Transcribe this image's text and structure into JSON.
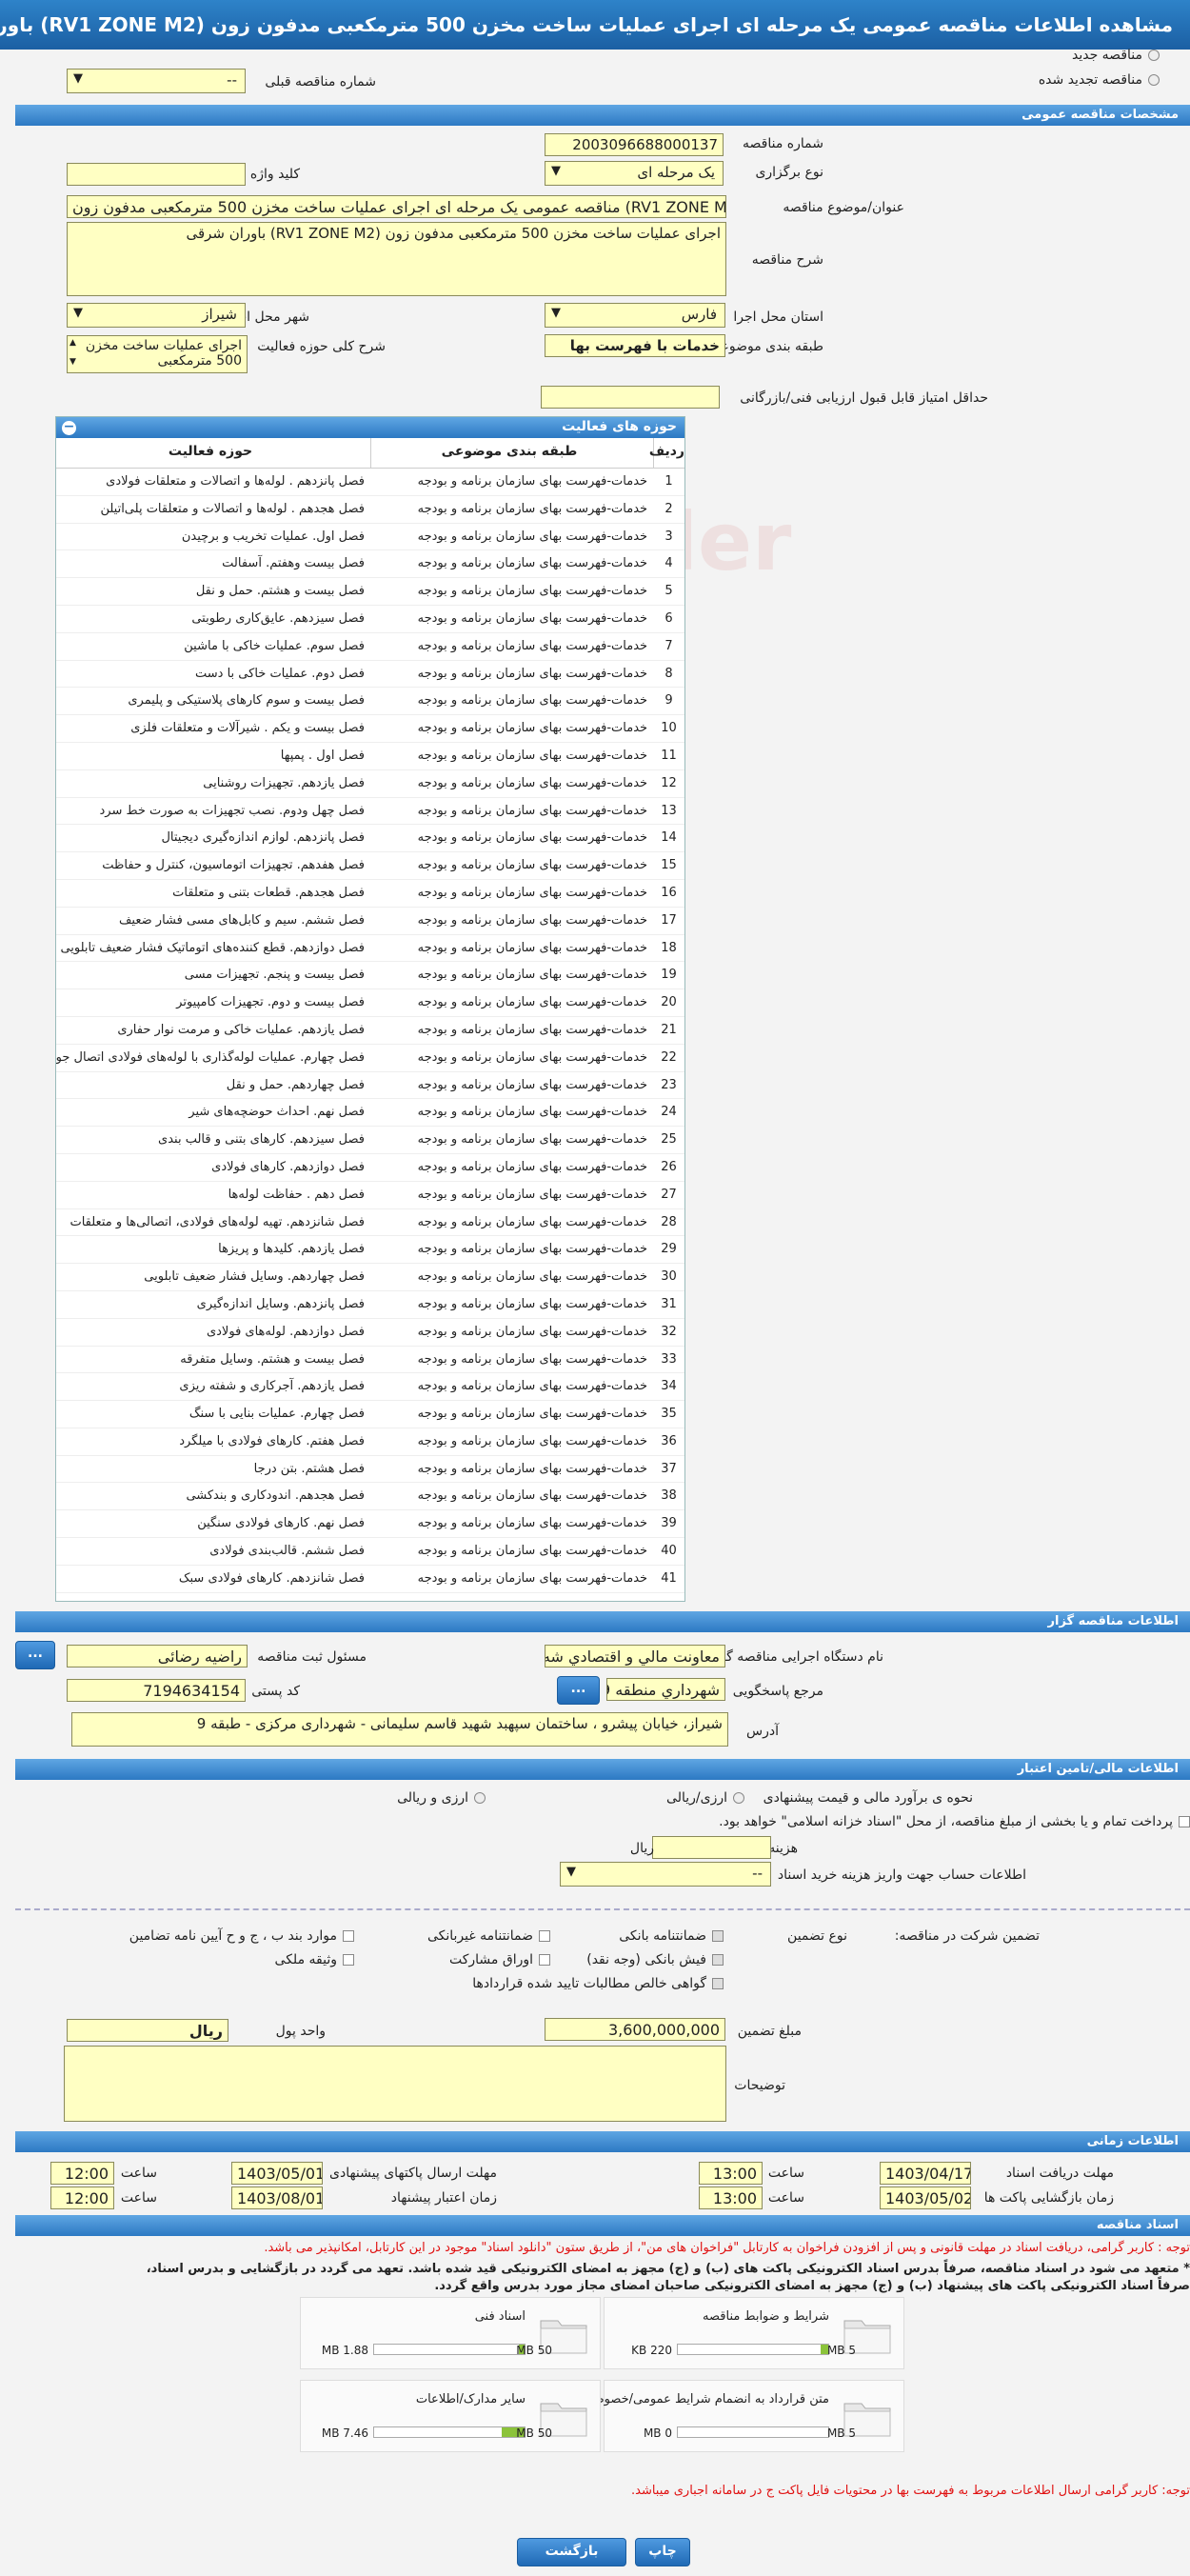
{
  "page_title": "مشاهده اطلاعات مناقصه عمومی یک مرحله ای اجرای عملیات ساخت مخزن 500 مترمکعبی مدفون زون (RV1 ZONE M2) باوران شرقی",
  "top": {
    "new_label": "مناقصه جدید",
    "renewed_label": "مناقصه تجدید شده",
    "prev_number_label": "شماره مناقصه قبلی",
    "prev_number_value": "--"
  },
  "general": {
    "header": "مشخصات مناقصه عمومی",
    "number_label": "شماره مناقصه",
    "number_value": "2003096688000137",
    "type_label": "نوع برگزاری",
    "type_value": "یک مرحله ای",
    "keyword_label": "کلید واژه",
    "subject_label": "عنوان/موضوع مناقصه",
    "subject_value": "مناقصه عمومی یک مرحله ای اجرای عملیات ساخت مخزن 500 مترمکعبی مدفون زون (RV1 ZONE M2",
    "desc_label": "شرح مناقصه",
    "desc_value": "اجرای عملیات ساخت مخزن 500 مترمکعبی مدفون زون (RV1 ZONE M2) باوران شرقی",
    "province_label": "استان محل اجرا",
    "province_value": "فارس",
    "city_label": "شهر محل اجرا",
    "city_value": "شیراز",
    "category_label": "طبقه بندی موضوعی",
    "category_value": "خدمات با فهرست بها",
    "scope_label": "شرح کلی حوزه فعالیت",
    "scope_value": "اجرای عملیات ساخت مخزن 500 مترمکعبی",
    "min_score_label": "حداقل امتیاز قابل قبول ارزیابی فنی/بازرگانی"
  },
  "activities": {
    "header": "حوزه های فعالیت",
    "col_row": "ردیف",
    "col_cat": "طبقه بندی موضوعی",
    "col_field": "حوزه فعالیت",
    "cat_value": "خدمات-فهرست بهای سازمان برنامه و بودجه",
    "rows": [
      {
        "n": "1",
        "f": "فصل پانزدهم . لوله‌ها و اتصالات و متعلقات فولادی"
      },
      {
        "n": "2",
        "f": "فصل هجدهم . لوله‌ها و اتصالات و متعلقات  پلی‌اتیلن"
      },
      {
        "n": "3",
        "f": "فصل اول. عملیات تخریب و برچیدن"
      },
      {
        "n": "4",
        "f": "فصل بیست وهفتم. آسفالت"
      },
      {
        "n": "5",
        "f": "فصل بیست و هشتم. حمل و نقل"
      },
      {
        "n": "6",
        "f": "فصل سیزدهم. عایق‌کاری رطوبتی"
      },
      {
        "n": "7",
        "f": "فصل سوم. عملیات خاکی با ماشین"
      },
      {
        "n": "8",
        "f": "فصل دوم. عملیات خاکی با دست"
      },
      {
        "n": "9",
        "f": "فصل بیست و سوم کارهای پلاستیکی و پلیمری"
      },
      {
        "n": "10",
        "f": "فصل بیست و یکم . شیرآلات و متعلقات فلزی"
      },
      {
        "n": "11",
        "f": "فصل اول . پمپها"
      },
      {
        "n": "12",
        "f": "فصل یازدهم. تجهیزات روشنایی"
      },
      {
        "n": "13",
        "f": "فصل چهل ودوم. نصب تجهیزات به صورت خط سرد"
      },
      {
        "n": "14",
        "f": "فصل پانزدهم. لوازم اندازه‌گیری دیجیتال"
      },
      {
        "n": "15",
        "f": "فصل هفدهم. تجهیزات اتوماسیون، کنترل و حفاظت"
      },
      {
        "n": "16",
        "f": "فصل هجدهم. قطعات بتنی و متعلقات"
      },
      {
        "n": "17",
        "f": "فصل ششم. سیم و کابل‌های مسی فشار ضعیف"
      },
      {
        "n": "18",
        "f": "فصل دوازدهم. قطع کننده‌های اتوماتیک فشار ضعیف تابلویی"
      },
      {
        "n": "19",
        "f": "فصل بیست و پنجم. تجهیزات مسی"
      },
      {
        "n": "20",
        "f": "فصل بیست و دوم. تجهیزات کامپیوتر"
      },
      {
        "n": "21",
        "f": "فصل یازدهم. عملیات خاکی و مرمت نوار حفاری"
      },
      {
        "n": "22",
        "f": "فصل چهارم. عملیات لوله‌گذاری با لوله‌های فولادی اتصال جوشی"
      },
      {
        "n": "23",
        "f": "فصل چهاردهم. حمل و نقل"
      },
      {
        "n": "24",
        "f": "فصل نهم. احداث حوضچه‌های شیر"
      },
      {
        "n": "25",
        "f": "فصل سیزدهم. کارهای بتنی و قالب بندی"
      },
      {
        "n": "26",
        "f": "فصل دوازدهم. کارهای فولادی"
      },
      {
        "n": "27",
        "f": "فصل دهم . حفاظت لوله‌ها"
      },
      {
        "n": "28",
        "f": "فصل شانزدهم. تهیه لوله‌های فولادی، اتصالی‌ها و متعلقات"
      },
      {
        "n": "29",
        "f": "فصل یازدهم. کلیدها و پریزها"
      },
      {
        "n": "30",
        "f": "فصل چهاردهم. وسایل فشار ضعیف تابلویی"
      },
      {
        "n": "31",
        "f": "فصل پانزدهم. وسایل اندازه‌گیری"
      },
      {
        "n": "32",
        "f": "فصل دوازدهم. لوله‌های فولادی"
      },
      {
        "n": "33",
        "f": "فصل بیست و هشتم. وسایل متفرقه"
      },
      {
        "n": "34",
        "f": "فصل یازدهم. آجرکاری و شفته ریزی"
      },
      {
        "n": "35",
        "f": "فصل چهارم. عملیات بنایی با سنگ"
      },
      {
        "n": "36",
        "f": "فصل هفتم. کارهای فولادی با میلگرد"
      },
      {
        "n": "37",
        "f": "فصل هشتم. بتن درجا"
      },
      {
        "n": "38",
        "f": "فصل هجدهم. اندودکاری و بندکشی"
      },
      {
        "n": "39",
        "f": "فصل نهم. کارهای فولادی سنگین"
      },
      {
        "n": "40",
        "f": "فصل ششم. قالب‌بندی فولادی"
      },
      {
        "n": "41",
        "f": "فصل شانزدهم. کارهای فولادی سبک"
      }
    ]
  },
  "organizer": {
    "header": "اطلاعات مناقصه گزار",
    "org_label": "نام دستگاه اجرایی مناقصه گزار",
    "org_value": "معاونت مالي و اقتصادي شه",
    "responsible_label": "مسئول ثبت مناقصه",
    "responsible_value": "راضیه رضائی",
    "ref_label": "مرجع پاسخگویی",
    "ref_value": "شهرداري منطقه 9",
    "postal_label": "کد پستی",
    "postal_value": "7194634154",
    "address_label": "آدرس",
    "address_value": "شیراز، خیابان پیشرو ، ساختمان سپهبد شهید قاسم سلیمانی - شهرداری مرکزی - طبقه 9",
    "btn_dots": "..."
  },
  "finance": {
    "header": "اطلاعات مالی/تامین اعتبار",
    "estimate_label": "نحوه ی برآورد مالی و قیمت پیشنهادی",
    "opt_rial": "ارزی/ریالی",
    "opt_fx": "ارزی و ریالی",
    "pay_note": "پرداخت تمام و یا بخشی از مبلغ مناقصه، از محل \"اسناد خزانه اسلامی\" خواهد بود.",
    "doc_cost_label": "هزینه خرید اسناد",
    "doc_cost_unit": "ریال",
    "account_label": "اطلاعات حساب جهت واریز هزینه خرید اسناد",
    "account_value": "--",
    "guarantee_label": "تضمین شرکت در مناقصه:",
    "guarantee_type_label": "نوع تضمین",
    "g1": "ضمانتنامه بانکی",
    "g2": "ضمانتنامه غیربانکی",
    "g3": "موارد بند ب ، ج و ح آیین نامه تضامین",
    "g4": "فیش بانکی (وجه نقد)",
    "g5": "اوراق مشارکت",
    "g6": "وثیقه ملکی",
    "g7": "گواهی خالص مطالبات تایید شده قراردادها",
    "amount_label": "مبلغ تضمین",
    "amount_value": "3,600,000,000",
    "currency_label": "واحد پول",
    "currency_value": "ریال",
    "notes_label": "توضیحات"
  },
  "timing": {
    "header": "اطلاعات زمانی",
    "doc_deadline_label": "مهلت دریافت اسناد",
    "doc_deadline_date": "1403/04/17",
    "doc_deadline_time": "13:00",
    "send_deadline_label": "مهلت ارسال پاکتهای پیشنهادی",
    "send_deadline_date": "1403/05/01",
    "send_deadline_time": "12:00",
    "open_label": "زمان بازگشایی پاکت ها",
    "open_date": "1403/05/02",
    "open_time": "13:00",
    "validity_label": "زمان اعتبار پیشنهاد",
    "validity_date": "1403/08/01",
    "validity_time": "12:00",
    "time_label": "ساعت"
  },
  "docs": {
    "header": "اسناد مناقصه",
    "note1": "توجه : کاربر گرامی، دریافت اسناد در مهلت قانونی و پس از افزودن فراخوان به کارتابل \"فراخوان های من\"، از طریق ستون \"دانلود اسناد\" موجود در این کارتابل، امکانپذیر می باشد.",
    "note2": "* متعهد می شود در اسناد مناقصه، صرفاً بدرس اسناد الکترونیکی پاکت های (ب) و (ج) مجهز به امضای الکترونیکی قید شده باشد. تعهد می گردد در بازگشایی و بدرس اسناد،",
    "note3": "صرفاً اسناد الکترونیکی پاکت های پیشنهاد (ب) و (ج) مجهز به امضای الکترونیکی صاحبان امضای مجاز مورد بدرس واقع گردد.",
    "files": [
      {
        "name": "شرایط و ضوابط مناقصه",
        "size": "220 KB",
        "max": "5 MB",
        "pct": 5
      },
      {
        "name": "اسناد فنی",
        "size": "1.88 MB",
        "max": "50 MB",
        "pct": 4
      },
      {
        "name": "متن قرارداد به انضمام شرایط عمومی/خصوصی",
        "size": "0 MB",
        "max": "5 MB",
        "pct": 0
      },
      {
        "name": "سایر مدارک/اطلاعات",
        "size": "7.46 MB",
        "max": "50 MB",
        "pct": 15
      }
    ],
    "note4": "توجه: کاربر گرامی ارسال اطلاعات مربوط به فهرست بها در محتویات فایل پاکت ج در سامانه اجباری میباشد."
  },
  "buttons": {
    "back": "بازگشت",
    "print": "چاپ"
  }
}
